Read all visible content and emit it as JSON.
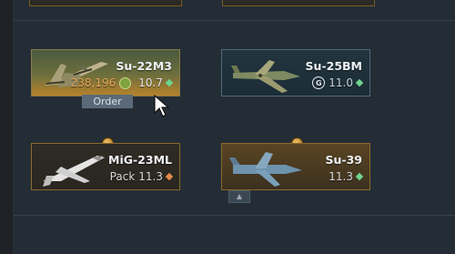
{
  "vehicles": [
    {
      "name": "Su-22M3",
      "cost": "238,196",
      "cost_currency_icon": "eagle-icon",
      "br": "10.7",
      "rank_color": "#6fd38f",
      "state": "researching"
    },
    {
      "name": "Su-25BM",
      "cost_currency_icon": "golden-eagle-icon",
      "br": "11.0",
      "rank_color": "#6fd38f",
      "state": "locked"
    },
    {
      "name": "MiG-23ML",
      "prefix": "Pack",
      "br": "11.3",
      "rank_color": "#e38a4a",
      "state": "premium"
    },
    {
      "name": "Su-39",
      "br": "11.3",
      "rank_color": "#6fd38f",
      "state": "premium"
    }
  ],
  "order_label": "Order",
  "colors": {
    "background": "#242d35",
    "gold": "#b58a3a",
    "cost_orange": "#e7a75a"
  }
}
